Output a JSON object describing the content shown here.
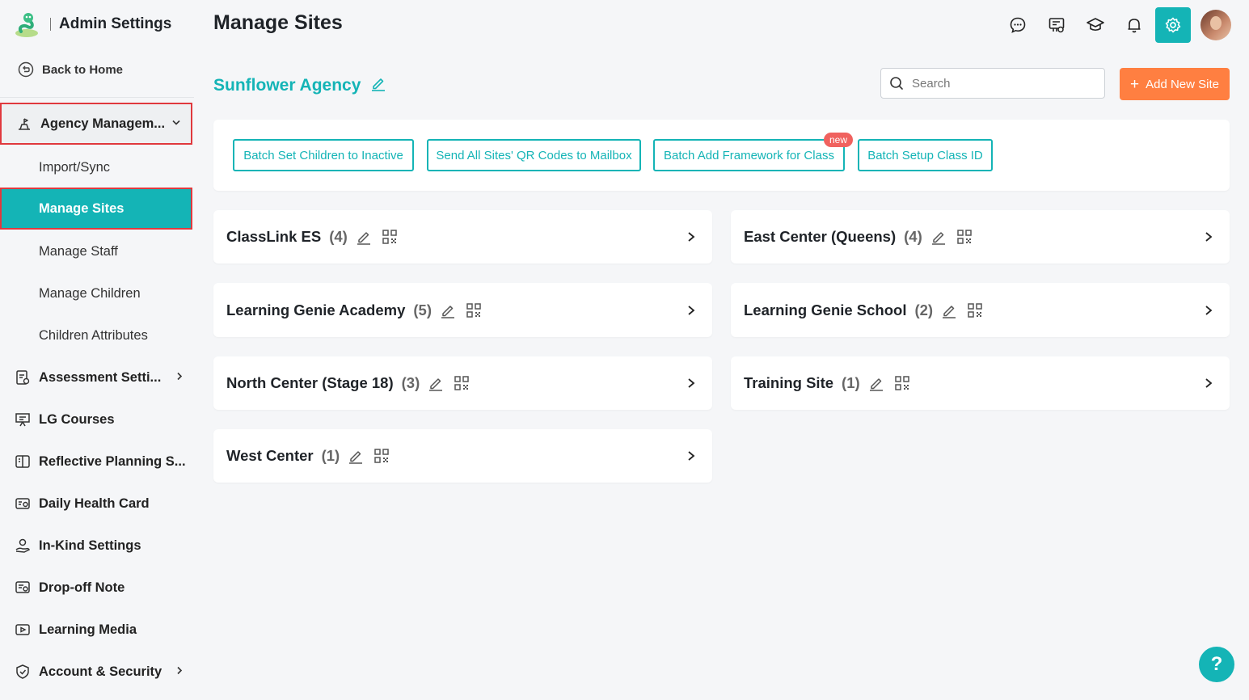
{
  "app": {
    "title": "Admin Settings",
    "logo_icon": "learning-genie-logo-icon"
  },
  "sidebar": {
    "back_label": "Back to Home",
    "items": [
      {
        "label": "Agency Managem...",
        "icon": "agency-icon"
      },
      {
        "label": "Assessment Setti...",
        "icon": "assessment-icon"
      },
      {
        "label": "LG Courses",
        "icon": "courses-icon"
      },
      {
        "label": "Reflective Planning S...",
        "icon": "planning-icon"
      },
      {
        "label": "Daily Health Card",
        "icon": "health-card-icon"
      },
      {
        "label": "In-Kind Settings",
        "icon": "in-kind-icon"
      },
      {
        "label": "Drop-off Note",
        "icon": "note-icon"
      },
      {
        "label": "Learning Media",
        "icon": "media-icon"
      },
      {
        "label": "Account & Security",
        "icon": "shield-icon"
      }
    ],
    "sub_items": [
      {
        "label": "Import/Sync"
      },
      {
        "label": "Manage Sites"
      },
      {
        "label": "Manage Staff"
      },
      {
        "label": "Manage Children"
      },
      {
        "label": "Children Attributes"
      }
    ]
  },
  "header": {
    "title": "Manage Sites"
  },
  "agency": {
    "name": "Sunflower Agency"
  },
  "search": {
    "placeholder": "Search",
    "value": ""
  },
  "add_site": {
    "label": "Add New Site"
  },
  "batch": {
    "buttons": [
      {
        "label": "Batch Set Children to Inactive"
      },
      {
        "label": "Send All Sites' QR Codes to Mailbox"
      },
      {
        "label": "Batch Add Framework for Class",
        "badge": "new"
      },
      {
        "label": "Batch Setup Class ID"
      }
    ]
  },
  "sites": [
    {
      "name": "ClassLink ES",
      "count": "(4)"
    },
    {
      "name": "East Center (Queens)",
      "count": "(4)"
    },
    {
      "name": "Learning Genie Academy",
      "count": "(5)"
    },
    {
      "name": "Learning Genie School",
      "count": "(2)"
    },
    {
      "name": "North Center (Stage 18)",
      "count": "(3)"
    },
    {
      "name": "Training Site",
      "count": "(1)"
    },
    {
      "name": "West Center",
      "count": "(1)"
    }
  ],
  "help": {
    "label": "?"
  },
  "colors": {
    "accent": "#14b4b6",
    "primary_button": "#ff7f41",
    "highlight_border": "#e0393e",
    "badge": "#f0625f"
  }
}
